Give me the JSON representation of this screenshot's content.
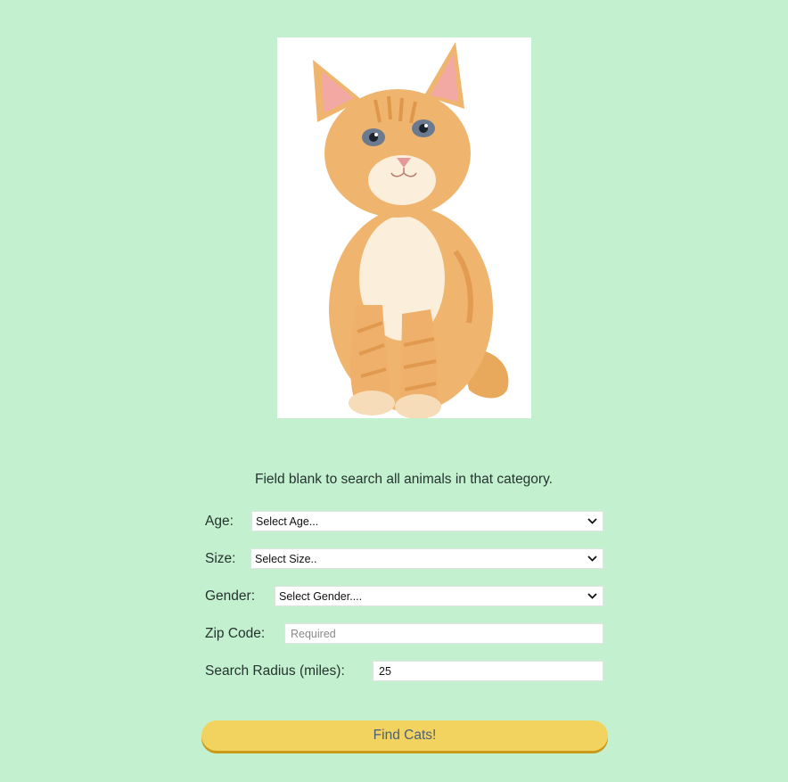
{
  "image": {
    "subject": "kitten-photo"
  },
  "hint_text": "Field blank to search all animals in that category.",
  "form": {
    "age": {
      "label": "Age:",
      "selected": "Select Age..."
    },
    "size": {
      "label": "Size:",
      "selected": "Select Size.."
    },
    "gender": {
      "label": "Gender:",
      "selected": "Select Gender...."
    },
    "zip": {
      "label": "Zip Code:",
      "placeholder": "Required",
      "value": ""
    },
    "radius": {
      "label": "Search Radius (miles):",
      "value": "25"
    }
  },
  "submit_label": "Find Cats!",
  "colors": {
    "background": "#c3f0cf",
    "button": "#f3d35f",
    "button_text": "#4a6079"
  }
}
